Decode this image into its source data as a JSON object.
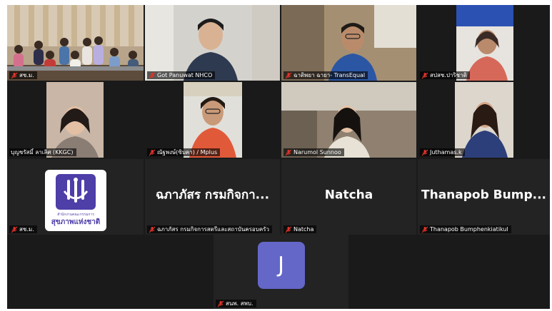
{
  "participants": [
    {
      "name": "สช.ม.",
      "kind": "video",
      "active": true
    },
    {
      "name": "Got Panuwat NHCO",
      "kind": "video"
    },
    {
      "name": "ฉาติพยา ฉายา- TransEqual",
      "kind": "video"
    },
    {
      "name": "สปสช.ปาริชาติ",
      "kind": "video"
    },
    {
      "name": "บุญชรัสมิ์ ลาเลิศ (KKGC)",
      "kind": "video"
    },
    {
      "name": "ณัฐพงษ์(ซิบคา) / Mplus",
      "kind": "video"
    },
    {
      "name": "Narumol Sunnoo",
      "kind": "video"
    },
    {
      "name": "Juthamas.k",
      "kind": "video"
    },
    {
      "name": "สช.ม.",
      "kind": "logo",
      "logo_line1": "สำนักงานคณะกรรมการ",
      "logo_line2": "สุขภาพแห่งชาติ"
    },
    {
      "name": "ฉภาภัสร กรมกิจการสตรีและสถาบันครอบครัว",
      "kind": "text",
      "display_name": "ฉภาภัสร กรมกิจกา..."
    },
    {
      "name": "Natcha",
      "kind": "text",
      "display_name": "Natcha"
    },
    {
      "name": "Thanapob Bumphenkiatikul",
      "kind": "text",
      "display_name": "Thanapob  Bump..."
    },
    {
      "name": "สนพ. สพบ.",
      "kind": "avatar",
      "avatar_letter": "J"
    }
  ],
  "colors": {
    "stage_bg": "#1a1a1a",
    "tile_bg": "#232323",
    "active_border": "#3fd469",
    "muted_mic": "#e0342b",
    "avatar_bg": "#6467c8",
    "logo_purple": "#4d3ea8"
  },
  "icons": {
    "mic": "muted-mic-icon"
  }
}
